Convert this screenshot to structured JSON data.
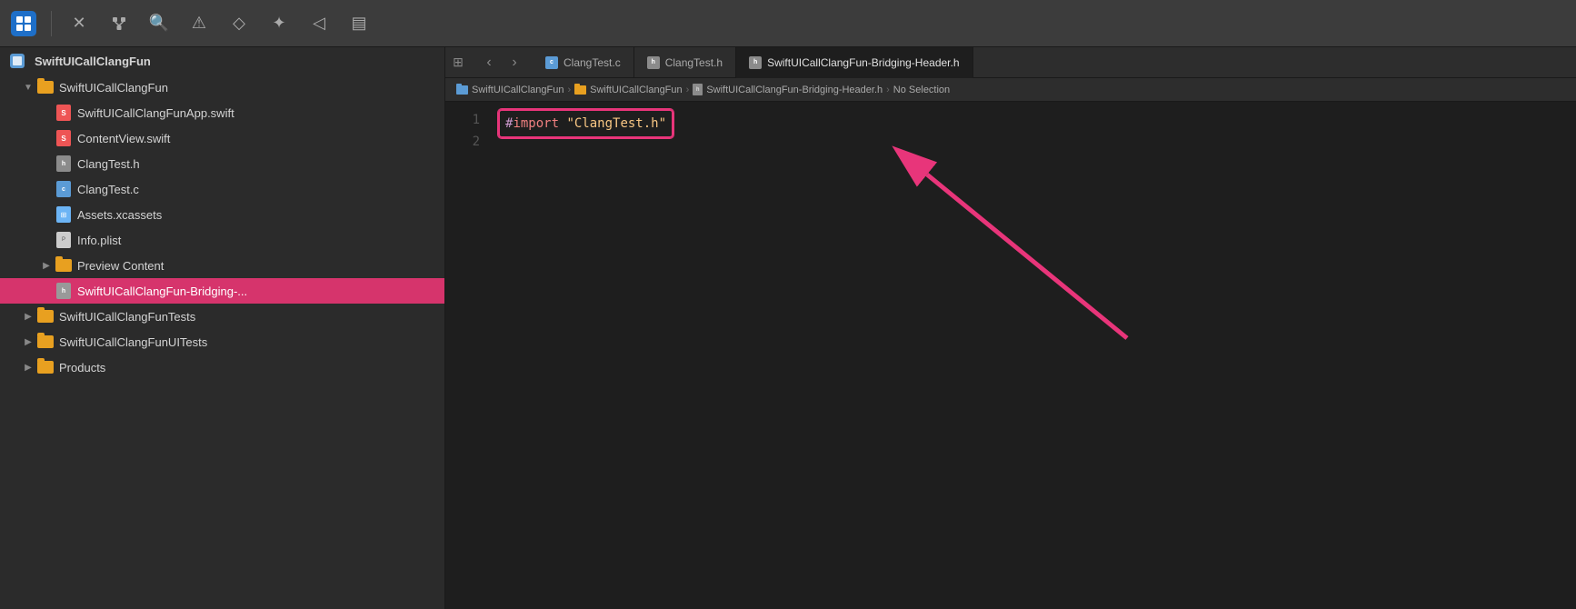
{
  "toolbar": {
    "icons": [
      "grid-icon",
      "close-icon",
      "hierarchy-icon",
      "search-icon",
      "warning-icon",
      "breakpoint-icon",
      "stamp-icon",
      "tag-icon",
      "list-icon"
    ]
  },
  "sidebar": {
    "rootProject": {
      "name": "SwiftUICallClangFun",
      "icon": "project-icon"
    },
    "items": [
      {
        "type": "folder",
        "name": "SwiftUICallClangFun",
        "indent": 1,
        "expanded": true,
        "color": "yellow"
      },
      {
        "type": "file-swift",
        "name": "SwiftUICallClangFunApp.swift",
        "indent": 2
      },
      {
        "type": "file-swift",
        "name": "ContentView.swift",
        "indent": 2
      },
      {
        "type": "file-h",
        "name": "ClangTest.h",
        "indent": 2
      },
      {
        "type": "file-c",
        "name": "ClangTest.c",
        "indent": 2
      },
      {
        "type": "file-xcassets",
        "name": "Assets.xcassets",
        "indent": 2
      },
      {
        "type": "file-plist",
        "name": "Info.plist",
        "indent": 2
      },
      {
        "type": "folder",
        "name": "Preview Content",
        "indent": 2,
        "expanded": false,
        "color": "yellow"
      },
      {
        "type": "file-h",
        "name": "SwiftUICallClangFun-Bridging-...",
        "indent": 2,
        "selected": true
      },
      {
        "type": "folder",
        "name": "SwiftUICallClangFunTests",
        "indent": 1,
        "expanded": false,
        "color": "yellow"
      },
      {
        "type": "folder",
        "name": "SwiftUICallClangFunUITests",
        "indent": 1,
        "expanded": false,
        "color": "yellow"
      },
      {
        "type": "folder",
        "name": "Products",
        "indent": 1,
        "expanded": false,
        "color": "yellow"
      }
    ]
  },
  "tabs": [
    {
      "id": "clangtest-c",
      "label": "ClangTest.c",
      "fileType": "c",
      "active": false
    },
    {
      "id": "clangtest-h",
      "label": "ClangTest.h",
      "fileType": "h",
      "active": false
    },
    {
      "id": "bridging-header",
      "label": "SwiftUICallClangFun-Bridging-Header.h",
      "fileType": "h",
      "active": true
    }
  ],
  "breadcrumb": {
    "items": [
      {
        "type": "project",
        "label": "SwiftUICallClangFun"
      },
      {
        "type": "folder-yellow",
        "label": "SwiftUICallClangFun"
      },
      {
        "type": "file-h",
        "label": "SwiftUICallClangFun-Bridging-Header.h"
      },
      {
        "type": "text",
        "label": "No Selection"
      }
    ]
  },
  "editor": {
    "lines": [
      {
        "number": "1",
        "content_type": "import",
        "text": "#import \"ClangTest.h\""
      },
      {
        "number": "2",
        "content_type": "empty",
        "text": ""
      }
    ]
  },
  "colors": {
    "accent_pink": "#e8357a",
    "folder_yellow": "#e8a020",
    "folder_blue": "#5b9bd5",
    "active_tab_bg": "#1e1e1e",
    "sidebar_bg": "#2b2b2b",
    "toolbar_bg": "#3c3c3c"
  }
}
